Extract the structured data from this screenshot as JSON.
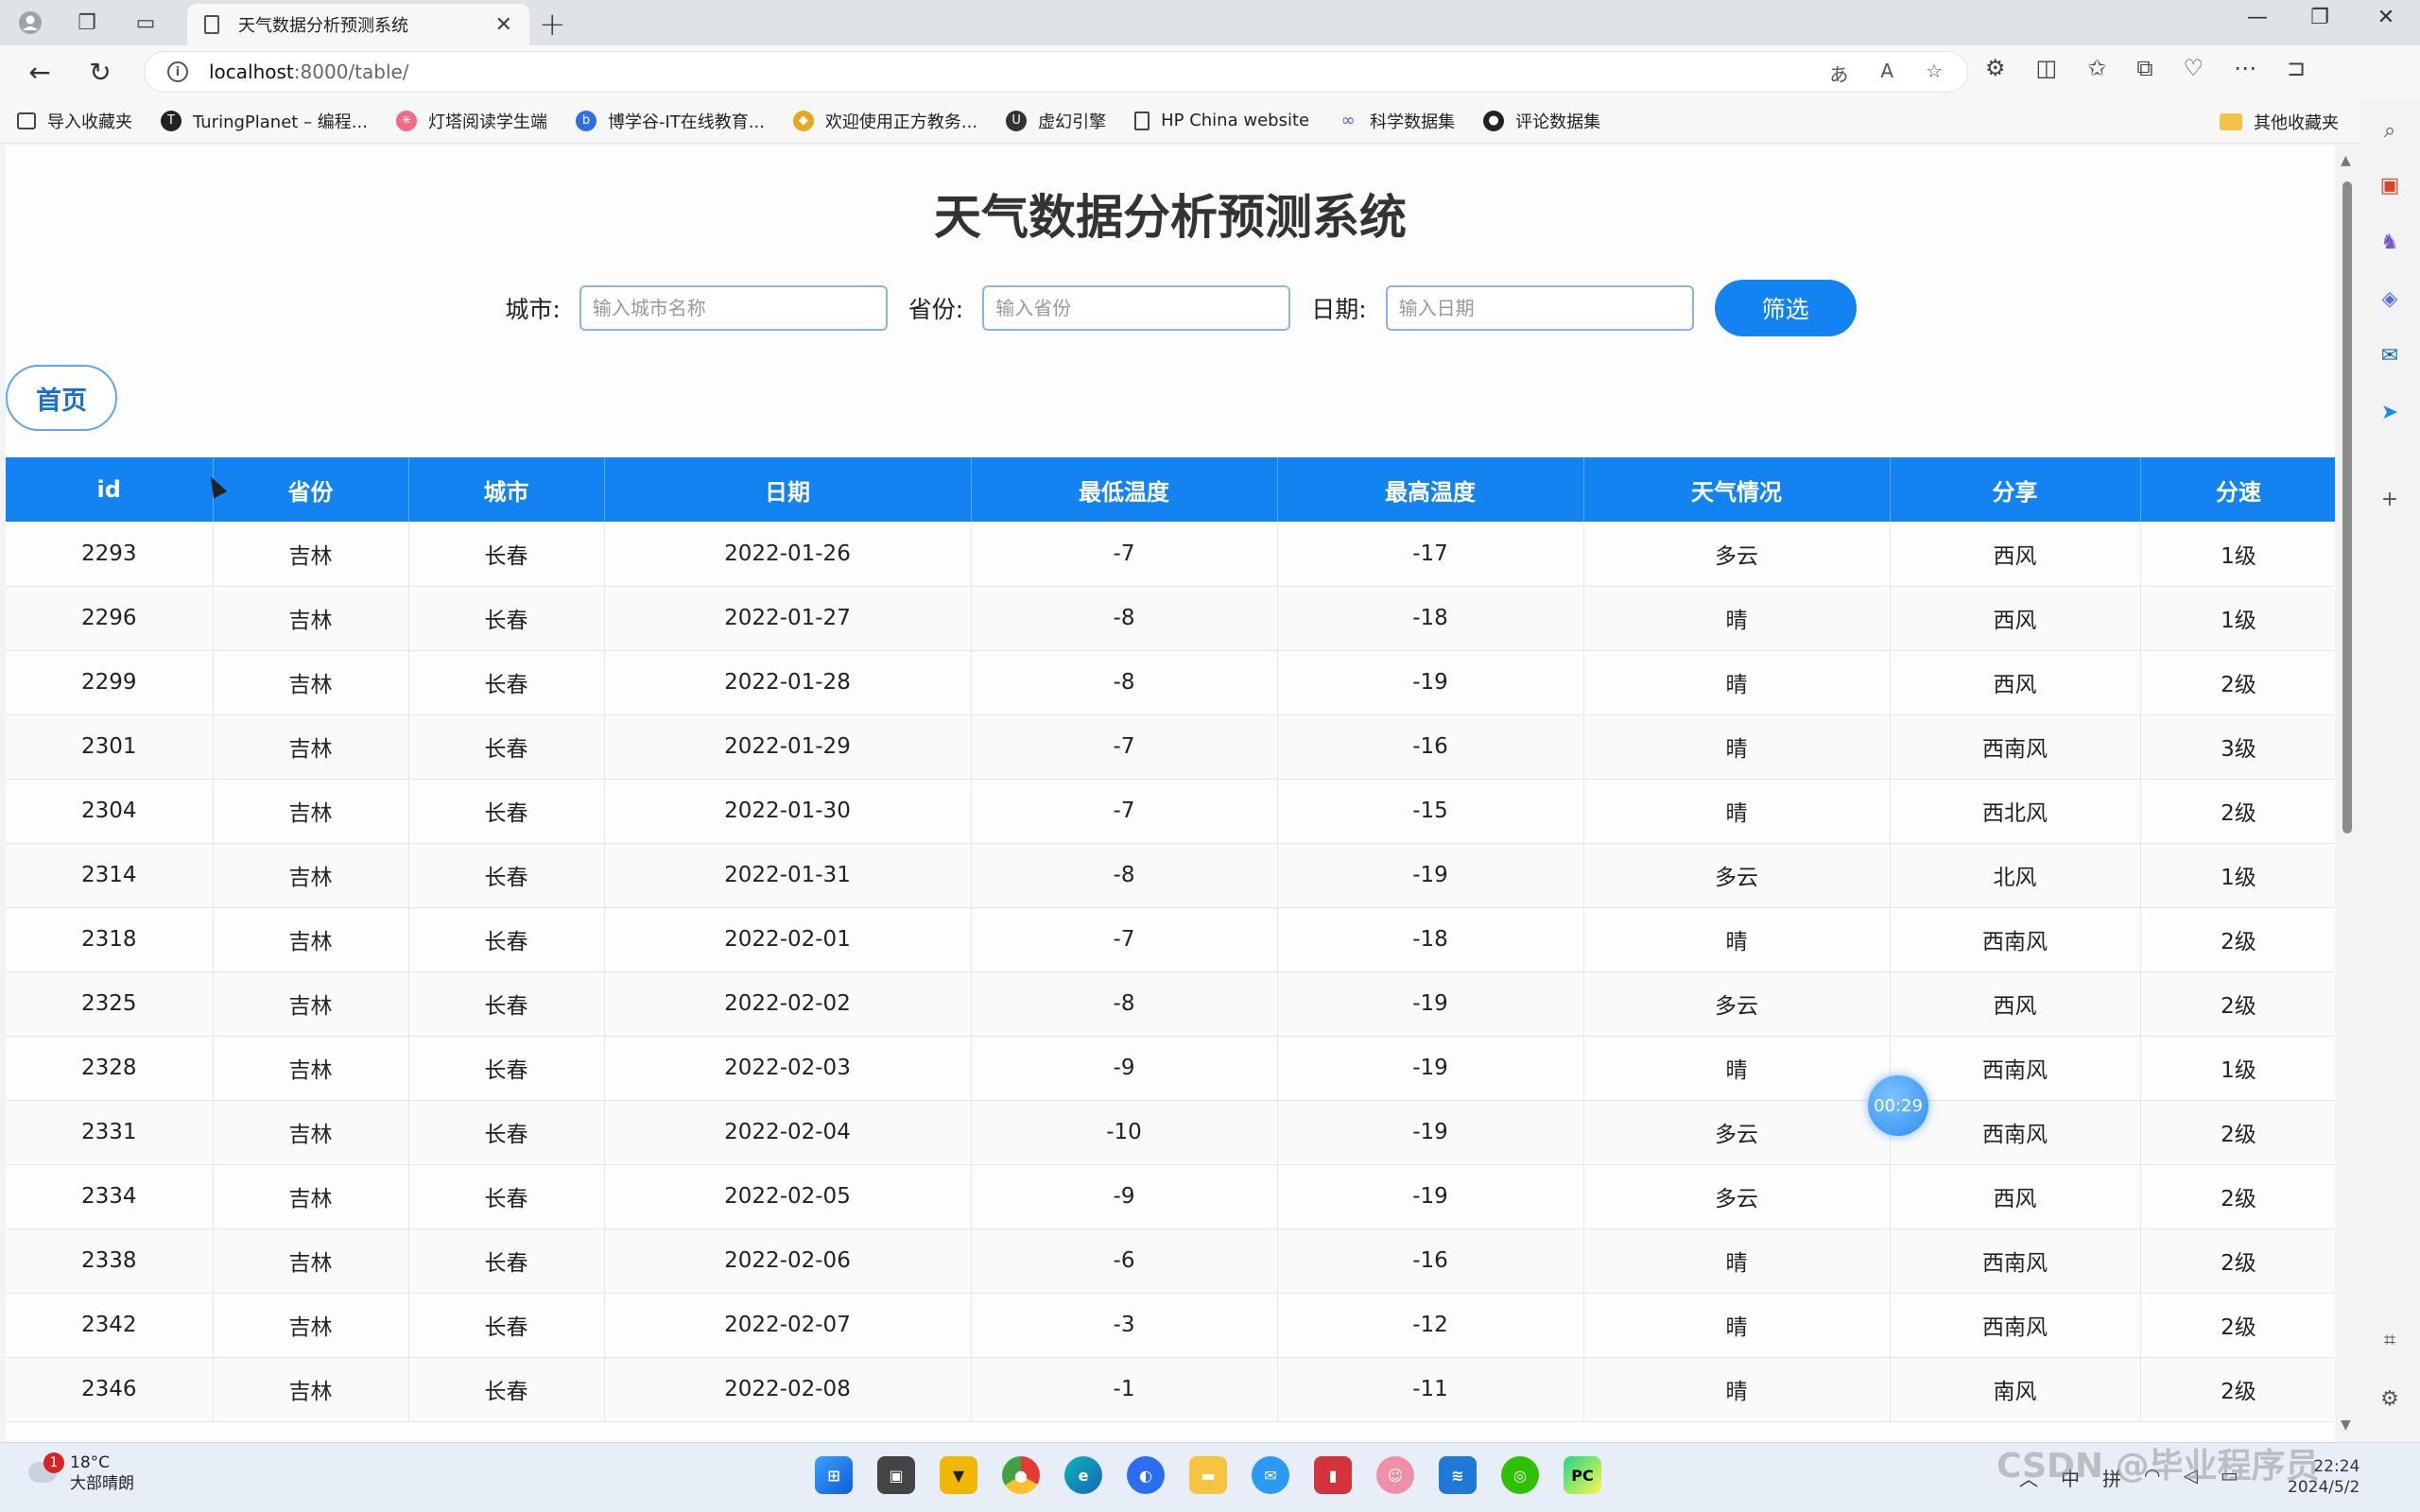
{
  "browser": {
    "tab_title": "天气数据分析预测系统",
    "url_host": "localhost",
    "url_path": ":8000/table/",
    "bookmarks": [
      "导入收藏夹",
      "TuringPlanet – 编程...",
      "灯塔阅读学生端",
      "博学谷-IT在线教育...",
      "欢迎使用正方教务...",
      "虚幻引擎",
      "HP China website",
      "科学数据集",
      "评论数据集"
    ],
    "other_bookmarks": "其他收藏夹"
  },
  "page": {
    "title": "天气数据分析预测系统",
    "filter": {
      "city_label": "城市:",
      "city_placeholder": "输入城市名称",
      "province_label": "省份:",
      "province_placeholder": "输入省份",
      "date_label": "日期:",
      "date_placeholder": "输入日期",
      "button": "筛选"
    },
    "home_button": "首页",
    "table": {
      "headers": [
        "id",
        "省份",
        "城市",
        "日期",
        "最低温度",
        "最高温度",
        "天气情况",
        "分享",
        "分速"
      ],
      "rows": [
        [
          "2293",
          "吉林",
          "长春",
          "2022-01-26",
          "-7",
          "-17",
          "多云",
          "西风",
          "1级"
        ],
        [
          "2296",
          "吉林",
          "长春",
          "2022-01-27",
          "-8",
          "-18",
          "晴",
          "西风",
          "1级"
        ],
        [
          "2299",
          "吉林",
          "长春",
          "2022-01-28",
          "-8",
          "-19",
          "晴",
          "西风",
          "2级"
        ],
        [
          "2301",
          "吉林",
          "长春",
          "2022-01-29",
          "-7",
          "-16",
          "晴",
          "西南风",
          "3级"
        ],
        [
          "2304",
          "吉林",
          "长春",
          "2022-01-30",
          "-7",
          "-15",
          "晴",
          "西北风",
          "2级"
        ],
        [
          "2314",
          "吉林",
          "长春",
          "2022-01-31",
          "-8",
          "-19",
          "多云",
          "北风",
          "1级"
        ],
        [
          "2318",
          "吉林",
          "长春",
          "2022-02-01",
          "-7",
          "-18",
          "晴",
          "西南风",
          "2级"
        ],
        [
          "2325",
          "吉林",
          "长春",
          "2022-02-02",
          "-8",
          "-19",
          "多云",
          "西风",
          "2级"
        ],
        [
          "2328",
          "吉林",
          "长春",
          "2022-02-03",
          "-9",
          "-19",
          "晴",
          "西南风",
          "1级"
        ],
        [
          "2331",
          "吉林",
          "长春",
          "2022-02-04",
          "-10",
          "-19",
          "多云",
          "西南风",
          "2级"
        ],
        [
          "2334",
          "吉林",
          "长春",
          "2022-02-05",
          "-9",
          "-19",
          "多云",
          "西风",
          "2级"
        ],
        [
          "2338",
          "吉林",
          "长春",
          "2022-02-06",
          "-6",
          "-16",
          "晴",
          "西南风",
          "2级"
        ],
        [
          "2342",
          "吉林",
          "长春",
          "2022-02-07",
          "-3",
          "-12",
          "晴",
          "西南风",
          "2级"
        ],
        [
          "2346",
          "吉林",
          "长春",
          "2022-02-08",
          "-1",
          "-11",
          "晴",
          "南风",
          "2级"
        ]
      ]
    },
    "timer_badge": "00:29"
  },
  "taskbar": {
    "weather_temp": "18°C",
    "weather_desc": "大部晴朗",
    "weather_badge": "1",
    "time": "22:24",
    "date": "2024/5/2",
    "watermark": "CSDN @毕业程序员"
  }
}
